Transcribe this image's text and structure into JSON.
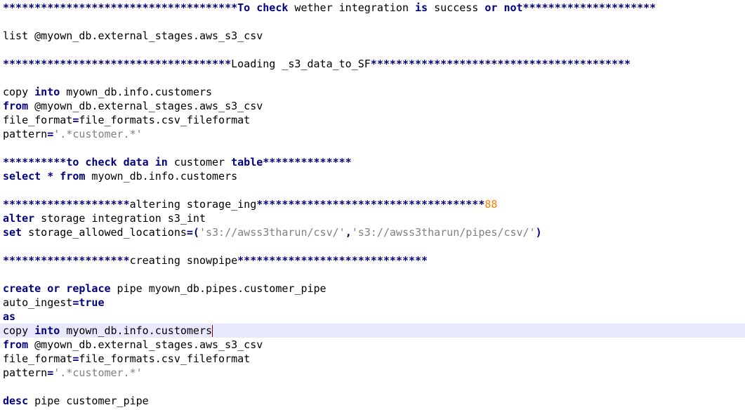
{
  "editor": {
    "colors": {
      "background": "#ffffff",
      "current_line": "#e8e8ff",
      "keyword": "#0000ff",
      "operator": "#000080",
      "string": "#808080",
      "number": "#ff8000",
      "text": "#000000"
    },
    "lines": [
      [
        {
          "t": "op",
          "v": "*************************************"
        },
        {
          "t": "kw",
          "v": "To check"
        },
        {
          "t": "text",
          "v": " wether integration "
        },
        {
          "t": "kw",
          "v": "is"
        },
        {
          "t": "text",
          "v": " success "
        },
        {
          "t": "kw",
          "v": "or not"
        },
        {
          "t": "op",
          "v": "*********************"
        }
      ],
      [],
      [
        {
          "t": "text",
          "v": "list @myown_db.external_stages.aws_s3_csv"
        }
      ],
      [],
      [
        {
          "t": "op",
          "v": "************************************"
        },
        {
          "t": "text",
          "v": "Loading _s3_data_to_SF"
        },
        {
          "t": "op",
          "v": "*****************************************"
        }
      ],
      [],
      [
        {
          "t": "text",
          "v": "copy "
        },
        {
          "t": "kw",
          "v": "into"
        },
        {
          "t": "text",
          "v": " myown_db.info.customers"
        }
      ],
      [
        {
          "t": "kw",
          "v": "from"
        },
        {
          "t": "text",
          "v": " @myown_db.external_stages.aws_s3_csv"
        }
      ],
      [
        {
          "t": "text",
          "v": "file_format"
        },
        {
          "t": "op",
          "v": "="
        },
        {
          "t": "text",
          "v": "file_formats.csv_fileformat"
        }
      ],
      [
        {
          "t": "text",
          "v": "pattern"
        },
        {
          "t": "op",
          "v": "="
        },
        {
          "t": "str",
          "v": "'.*customer.*'"
        }
      ],
      [],
      [
        {
          "t": "op",
          "v": "**********"
        },
        {
          "t": "kw",
          "v": "to check data in"
        },
        {
          "t": "text",
          "v": " customer "
        },
        {
          "t": "kw",
          "v": "table"
        },
        {
          "t": "op",
          "v": "**************"
        }
      ],
      [
        {
          "t": "kw",
          "v": "select"
        },
        {
          "t": "text",
          "v": " "
        },
        {
          "t": "op",
          "v": "*"
        },
        {
          "t": "text",
          "v": " "
        },
        {
          "t": "kw",
          "v": "from"
        },
        {
          "t": "text",
          "v": " myown_db.info.customers"
        }
      ],
      [],
      [
        {
          "t": "op",
          "v": "********************"
        },
        {
          "t": "text",
          "v": "altering storage_ing"
        },
        {
          "t": "op",
          "v": "************************************"
        },
        {
          "t": "num",
          "v": "88"
        }
      ],
      [
        {
          "t": "kw",
          "v": "alter"
        },
        {
          "t": "text",
          "v": " storage integration s3_int"
        }
      ],
      [
        {
          "t": "kw",
          "v": "set"
        },
        {
          "t": "text",
          "v": " storage_allowed_locations"
        },
        {
          "t": "op",
          "v": "=("
        },
        {
          "t": "str",
          "v": "'s3://awss3tharun/csv/'"
        },
        {
          "t": "op",
          "v": ","
        },
        {
          "t": "str",
          "v": "'s3://awss3tharun/pipes/csv/'"
        },
        {
          "t": "op",
          "v": ")"
        }
      ],
      [],
      [
        {
          "t": "op",
          "v": "********************"
        },
        {
          "t": "text",
          "v": "creating snowpipe"
        },
        {
          "t": "op",
          "v": "******************************"
        }
      ],
      [],
      [
        {
          "t": "kw",
          "v": "create or replace"
        },
        {
          "t": "text",
          "v": " pipe myown_db.pipes.customer_pipe"
        }
      ],
      [
        {
          "t": "text",
          "v": "auto_ingest"
        },
        {
          "t": "op",
          "v": "="
        },
        {
          "t": "kw",
          "v": "true"
        }
      ],
      [
        {
          "t": "kw",
          "v": "as"
        }
      ],
      [
        {
          "t": "text",
          "v": "copy "
        },
        {
          "t": "kw",
          "v": "into"
        },
        {
          "t": "text",
          "v": " myown_db.info.customers"
        }
      ],
      [
        {
          "t": "kw",
          "v": "from"
        },
        {
          "t": "text",
          "v": " @myown_db.external_stages.aws_s3_csv"
        }
      ],
      [
        {
          "t": "text",
          "v": "file_format"
        },
        {
          "t": "op",
          "v": "="
        },
        {
          "t": "text",
          "v": "file_formats.csv_fileformat"
        }
      ],
      [
        {
          "t": "text",
          "v": "pattern"
        },
        {
          "t": "op",
          "v": "="
        },
        {
          "t": "str",
          "v": "'.*customer.*'"
        }
      ],
      [],
      [
        {
          "t": "kw",
          "v": "desc"
        },
        {
          "t": "text",
          "v": " pipe customer_pipe"
        }
      ]
    ],
    "current_line_index": 23
  }
}
